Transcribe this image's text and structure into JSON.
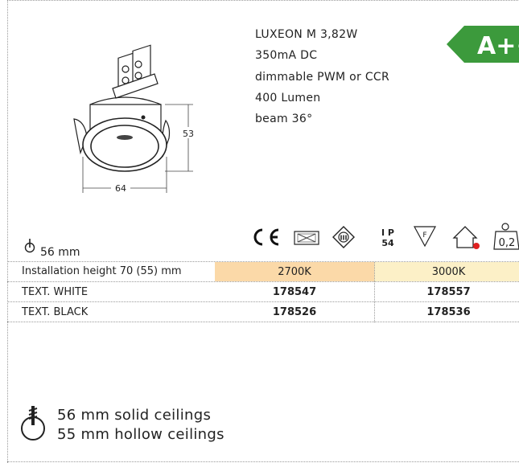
{
  "product": {
    "specs": [
      "LUXEON M 3,82W",
      "350mA DC",
      "dimmable PWM or CCR",
      "400 Lumen",
      "beam 36°"
    ],
    "dim_height": "53",
    "dim_width": "64",
    "energy_class": "A++",
    "cutout": "56 mm",
    "ip_top": "I P",
    "ip_bottom": "54",
    "weight": "0,2"
  },
  "table": {
    "install_label": "Installation height 70 (55) mm",
    "col1": "2700K",
    "col2": "3000K",
    "rows": [
      {
        "label": "TEXT. WHITE",
        "v1": "178547",
        "v2": "178557"
      },
      {
        "label": "TEXT. BLACK",
        "v1": "178526",
        "v2": "178536"
      }
    ]
  },
  "footer": {
    "line1": "56 mm solid ceilings",
    "line2": "55 mm hollow ceilings"
  },
  "colors": {
    "warm": "#fbd9a8",
    "neutral": "#fcf0c7",
    "energy": "#3c9a3c"
  }
}
